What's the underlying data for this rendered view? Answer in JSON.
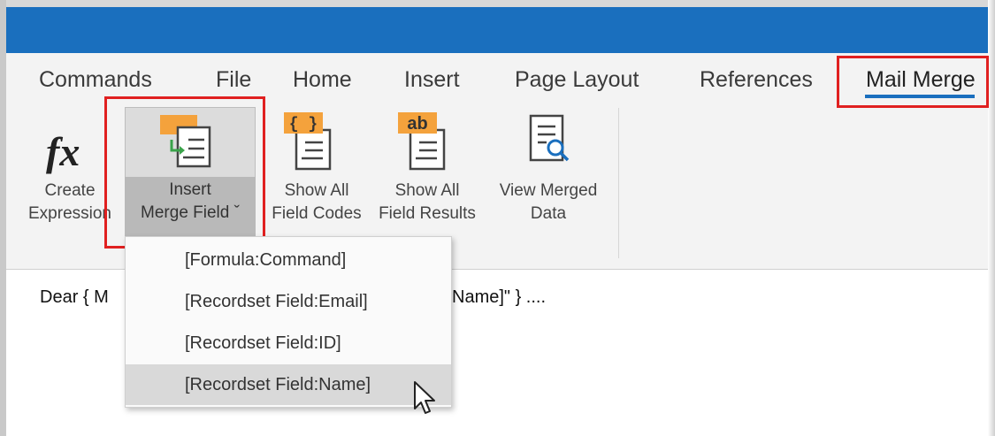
{
  "ribbon_tabs": [
    {
      "label": "Commands"
    },
    {
      "label": "File"
    },
    {
      "label": "Home"
    },
    {
      "label": "Insert"
    },
    {
      "label": "Page Layout"
    },
    {
      "label": "References"
    },
    {
      "label": "Mail Merge",
      "selected": true
    }
  ],
  "buttons": {
    "create_expression": {
      "line1": "Create",
      "line2": "Expression",
      "icon": "fx-icon"
    },
    "insert_merge_field": {
      "line1": "Insert",
      "line2": "Merge Field ˇ",
      "icon": "insert-merge-field-icon"
    },
    "show_all_field_codes": {
      "line1": "Show All",
      "line2": "Field Codes",
      "icon": "field-codes-icon",
      "badge": "{ }"
    },
    "show_all_field_results": {
      "line1": "Show All",
      "line2": "Field Results",
      "icon": "field-results-icon",
      "badge": "ab"
    },
    "view_merged_data": {
      "line1": "View Merged",
      "line2": "Data",
      "icon": "view-merged-data-icon"
    }
  },
  "document": {
    "text_left": "Dear { M",
    "text_right": "Name]\" } ...."
  },
  "dropdown": {
    "items": [
      {
        "label": "[Formula:Command]"
      },
      {
        "label": "[Recordset Field:Email]"
      },
      {
        "label": "[Recordset Field:ID]"
      },
      {
        "label": "[Recordset Field:Name]",
        "hovered": true
      }
    ]
  },
  "colors": {
    "title_bar": "#1a6fbe",
    "highlight_red": "#e02020",
    "badge_orange": "#f4a23c",
    "icon_green": "#3aa34a"
  }
}
